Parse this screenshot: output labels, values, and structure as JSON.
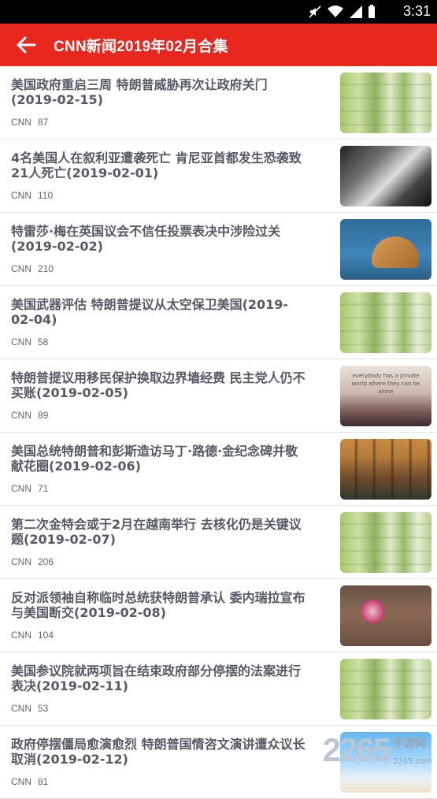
{
  "status_bar": {
    "time": "3:31"
  },
  "app_bar": {
    "title": "CNN新闻2019年02月合集"
  },
  "items": [
    {
      "title": "美国政府重启三周 特朗普威胁再次让政府关门(2019-02-15)",
      "source": "CNN",
      "count": "87",
      "thumb": "bamboo-image"
    },
    {
      "title": "4名美国人在叙利亚遭袭死亡 肯尼亚首都发生恐袭致21人死亡(2019-02-01)",
      "source": "CNN",
      "count": "110",
      "thumb": "girl-photo"
    },
    {
      "title": "特雷莎·梅在英国议会不信任投票表决中涉险过关(2019-02-02)",
      "source": "CNN",
      "count": "210",
      "thumb": "shoes-image"
    },
    {
      "title": "美国武器评估 特朗普提议从太空保卫美国(2019-02-04)",
      "source": "CNN",
      "count": "58",
      "thumb": "bamboo-image"
    },
    {
      "title": "特朗普提议用移民保护换取边界墙经费 民主党人仍不买账(2019-02-05)",
      "source": "CNN",
      "count": "89",
      "thumb": "sunset-image",
      "thumb_text": "everybody has a private world where they can be alone"
    },
    {
      "title": "美国总统特朗普和彭斯造访马丁·路德·金纪念碑并敬献花圈(2019-02-06)",
      "source": "CNN",
      "count": "71",
      "thumb": "forest-image"
    },
    {
      "title": "第二次金特会或于2月在越南举行 去核化仍是关键议题(2019-02-07)",
      "source": "CNN",
      "count": "206",
      "thumb": "bamboo-image"
    },
    {
      "title": "反对派领袖自称临时总统获特朗普承认 委内瑞拉宣布与美国断交(2019-02-08)",
      "source": "CNN",
      "count": "104",
      "thumb": "flower-image"
    },
    {
      "title": "美国参议院就两项旨在结束政府部分停摆的法案进行表决(2019-02-11)",
      "source": "CNN",
      "count": "53",
      "thumb": "bamboo-image"
    },
    {
      "title": "政府停摆僵局愈演愈烈 特朗普国情咨文演讲遭众议长取消(2019-02-12)",
      "source": "CNN",
      "count": "81",
      "thumb": "sky-image"
    }
  ],
  "watermark": {
    "number": "2265",
    "cn": "手游网",
    "url": "2265.com"
  },
  "colors": {
    "app_bar": "#e8281e",
    "title_text": "#555a66",
    "meta_text": "#666666"
  }
}
